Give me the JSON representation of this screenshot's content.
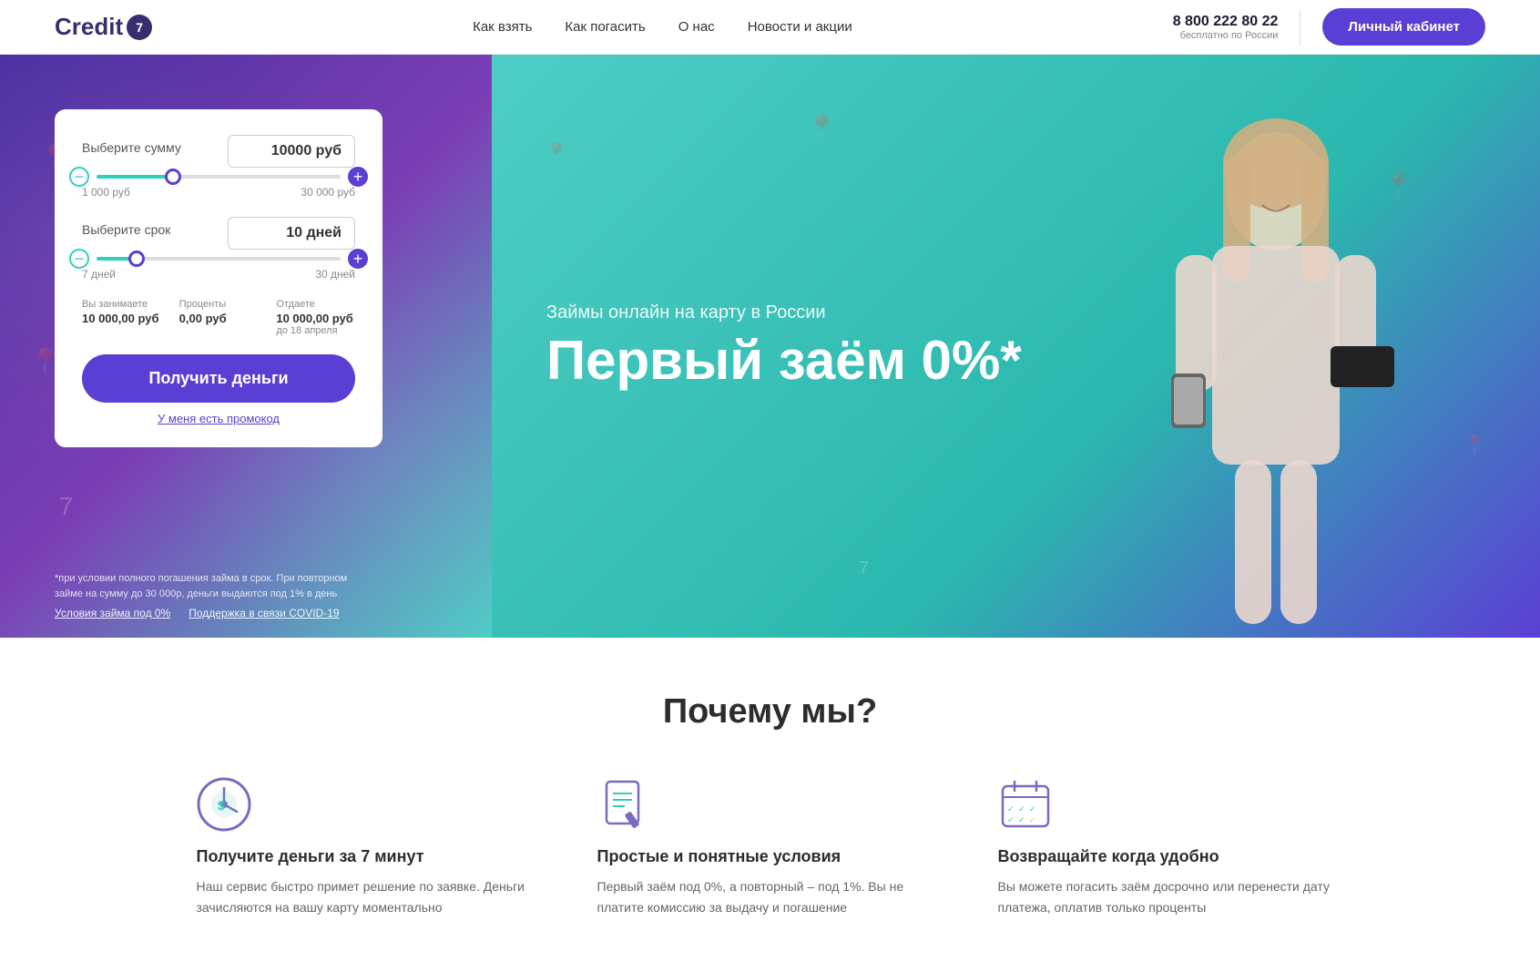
{
  "header": {
    "logo_text": "Credit",
    "logo_number": "7",
    "nav": [
      {
        "label": "Как взять",
        "href": "#"
      },
      {
        "label": "Как погасить",
        "href": "#"
      },
      {
        "label": "О нас",
        "href": "#"
      },
      {
        "label": "Новости и акции",
        "href": "#"
      }
    ],
    "phone": "8 800 222 80 22",
    "phone_sub": "бесплатно по России",
    "cabinet_btn": "Личный кабинет"
  },
  "hero": {
    "subtitle": "Займы онлайн на карту в России",
    "title": "Первый заём 0%*",
    "calc": {
      "amount_label": "Выберите сумму",
      "amount_value": "10000 руб",
      "amount_min": "1 000 руб",
      "amount_max": "30 000 руб",
      "term_label": "Выберите срок",
      "term_value": "10 дней",
      "term_min": "7 дней",
      "term_max": "30 дней",
      "borrow_label": "Вы занимаете",
      "borrow_value": "10 000,00 руб",
      "interest_label": "Проценты",
      "interest_value": "0,00 руб",
      "return_label": "Отдаете",
      "return_value": "10 000,00 руб",
      "return_date": "до 18 апреля",
      "get_money_btn": "Получить деньги",
      "promo_link": "У меня есть промокод"
    },
    "disclaimer": "*при условии полного погашения займа в срок. При повторном займе на сумму до 30 000р, деньги выдаются под 1% в день",
    "link1": "Условия займа под 0%",
    "link2": "Поддержка в связи COVID-19"
  },
  "why": {
    "title": "Почему мы?",
    "cards": [
      {
        "title": "Получите деньги за 7 минут",
        "text": "Наш сервис быстро примет решение по заявке. Деньги зачисляются на вашу карту моментально"
      },
      {
        "title": "Простые и понятные условия",
        "text": "Первый заём под 0%, а повторный – под 1%. Вы не платите комиссию за выдачу и погашение"
      },
      {
        "title": "Возвращайте когда удобно",
        "text": "Вы можете погасить заём досрочно или перенести дату платежа, оплатив только проценты"
      }
    ]
  }
}
